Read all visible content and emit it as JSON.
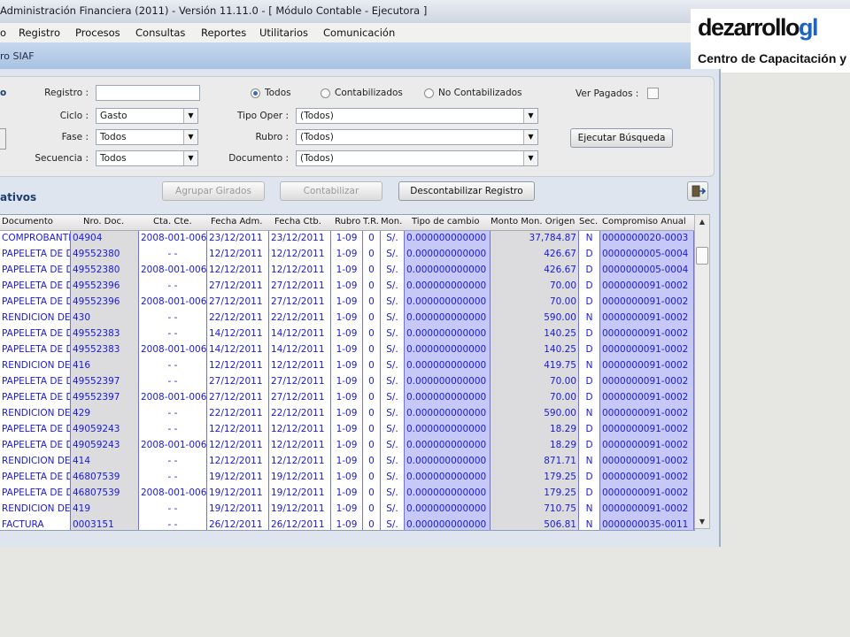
{
  "window": {
    "title": "Administración Financiera (2011) - Versión 11.11.0 - [ Módulo Contable - Ejecutora ]"
  },
  "menu": [
    "o",
    "Registro",
    "Procesos",
    "Consultas",
    "Reportes",
    "Utilitarios",
    "Comunicación"
  ],
  "strip_label": "ro SIAF",
  "logo": {
    "main": "dezarrollo",
    "accent": "gl",
    "sub": "Centro de Capacitación y",
    "accent_color": "#1c63c7"
  },
  "filters": {
    "side_label": "o",
    "registro_label": "Registro :",
    "registro_value": "",
    "ciclo_label": "Ciclo :",
    "ciclo_value": "Gasto",
    "fase_label": "Fase :",
    "fase_value": "Todos",
    "secuencia_label": "Secuencia :",
    "secuencia_value": "Todos",
    "radios": [
      {
        "label": "Todos",
        "checked": true
      },
      {
        "label": "Contabilizados",
        "checked": false
      },
      {
        "label": "No Contabilizados",
        "checked": false
      }
    ],
    "tipo_oper_label": "Tipo Oper :",
    "tipo_oper_value": "(Todos)",
    "rubro_label": "Rubro :",
    "rubro_value": "(Todos)",
    "documento_label": "Documento :",
    "documento_value": "(Todos)",
    "ver_pagados_label": "Ver Pagados :",
    "ver_pagados_checked": false,
    "buscar_button": "Ejecutar Búsqueda"
  },
  "section": {
    "title": "ativos",
    "btn_agrupar": "Agrupar Girados",
    "btn_contabilizar": "Contabilizar",
    "btn_descontabilizar": "Descontabilizar Registro"
  },
  "grid": {
    "columns": [
      "Documento",
      "Nro. Doc.",
      "Cta. Cte.",
      "Fecha Adm.",
      "Fecha Ctb.",
      "Rubro",
      "T.R.",
      "Mon.",
      "Tipo de cambio",
      "Monto Mon. Origen",
      "Sec.",
      "Compromiso Anual"
    ],
    "rows": [
      [
        "COMPROBANTE",
        "04904",
        "2008-001-006",
        "23/12/2011",
        "23/12/2011",
        "1-09",
        "0",
        "S/.",
        "0.000000000000",
        "37,784.87",
        "N",
        "0000000020-0003"
      ],
      [
        "PAPELETA DE D",
        "49552380",
        "- -",
        "12/12/2011",
        "12/12/2011",
        "1-09",
        "0",
        "S/.",
        "0.000000000000",
        "426.67",
        "D",
        "0000000005-0004"
      ],
      [
        "PAPELETA DE D",
        "49552380",
        "2008-001-006",
        "12/12/2011",
        "12/12/2011",
        "1-09",
        "0",
        "S/.",
        "0.000000000000",
        "426.67",
        "D",
        "0000000005-0004"
      ],
      [
        "PAPELETA DE D",
        "49552396",
        "- -",
        "27/12/2011",
        "27/12/2011",
        "1-09",
        "0",
        "S/.",
        "0.000000000000",
        "70.00",
        "D",
        "0000000091-0002"
      ],
      [
        "PAPELETA DE D",
        "49552396",
        "2008-001-006",
        "27/12/2011",
        "27/12/2011",
        "1-09",
        "0",
        "S/.",
        "0.000000000000",
        "70.00",
        "D",
        "0000000091-0002"
      ],
      [
        "RENDICION DE",
        "430",
        "- -",
        "22/12/2011",
        "22/12/2011",
        "1-09",
        "0",
        "S/.",
        "0.000000000000",
        "590.00",
        "N",
        "0000000091-0002"
      ],
      [
        "PAPELETA DE D",
        "49552383",
        "- -",
        "14/12/2011",
        "14/12/2011",
        "1-09",
        "0",
        "S/.",
        "0.000000000000",
        "140.25",
        "D",
        "0000000091-0002"
      ],
      [
        "PAPELETA DE D",
        "49552383",
        "2008-001-006",
        "14/12/2011",
        "14/12/2011",
        "1-09",
        "0",
        "S/.",
        "0.000000000000",
        "140.25",
        "D",
        "0000000091-0002"
      ],
      [
        "RENDICION DE",
        "416",
        "- -",
        "12/12/2011",
        "12/12/2011",
        "1-09",
        "0",
        "S/.",
        "0.000000000000",
        "419.75",
        "N",
        "0000000091-0002"
      ],
      [
        "PAPELETA DE D",
        "49552397",
        "- -",
        "27/12/2011",
        "27/12/2011",
        "1-09",
        "0",
        "S/.",
        "0.000000000000",
        "70.00",
        "D",
        "0000000091-0002"
      ],
      [
        "PAPELETA DE D",
        "49552397",
        "2008-001-006",
        "27/12/2011",
        "27/12/2011",
        "1-09",
        "0",
        "S/.",
        "0.000000000000",
        "70.00",
        "D",
        "0000000091-0002"
      ],
      [
        "RENDICION DE",
        "429",
        "- -",
        "22/12/2011",
        "22/12/2011",
        "1-09",
        "0",
        "S/.",
        "0.000000000000",
        "590.00",
        "N",
        "0000000091-0002"
      ],
      [
        "PAPELETA DE D",
        "49059243",
        "- -",
        "12/12/2011",
        "12/12/2011",
        "1-09",
        "0",
        "S/.",
        "0.000000000000",
        "18.29",
        "D",
        "0000000091-0002"
      ],
      [
        "PAPELETA DE D",
        "49059243",
        "2008-001-006",
        "12/12/2011",
        "12/12/2011",
        "1-09",
        "0",
        "S/.",
        "0.000000000000",
        "18.29",
        "D",
        "0000000091-0002"
      ],
      [
        "RENDICION DE",
        "414",
        "- -",
        "12/12/2011",
        "12/12/2011",
        "1-09",
        "0",
        "S/.",
        "0.000000000000",
        "871.71",
        "N",
        "0000000091-0002"
      ],
      [
        "PAPELETA DE D",
        "46807539",
        "- -",
        "19/12/2011",
        "19/12/2011",
        "1-09",
        "0",
        "S/.",
        "0.000000000000",
        "179.25",
        "D",
        "0000000091-0002"
      ],
      [
        "PAPELETA DE D",
        "46807539",
        "2008-001-006",
        "19/12/2011",
        "19/12/2011",
        "1-09",
        "0",
        "S/.",
        "0.000000000000",
        "179.25",
        "D",
        "0000000091-0002"
      ],
      [
        "RENDICION DE",
        "419",
        "- -",
        "19/12/2011",
        "19/12/2011",
        "1-09",
        "0",
        "S/.",
        "0.000000000000",
        "710.75",
        "N",
        "0000000091-0002"
      ],
      [
        "FACTURA",
        "0003151",
        "- -",
        "26/12/2011",
        "26/12/2011",
        "1-09",
        "0",
        "S/.",
        "0.000000000000",
        "506.81",
        "N",
        "0000000035-0011"
      ]
    ]
  }
}
